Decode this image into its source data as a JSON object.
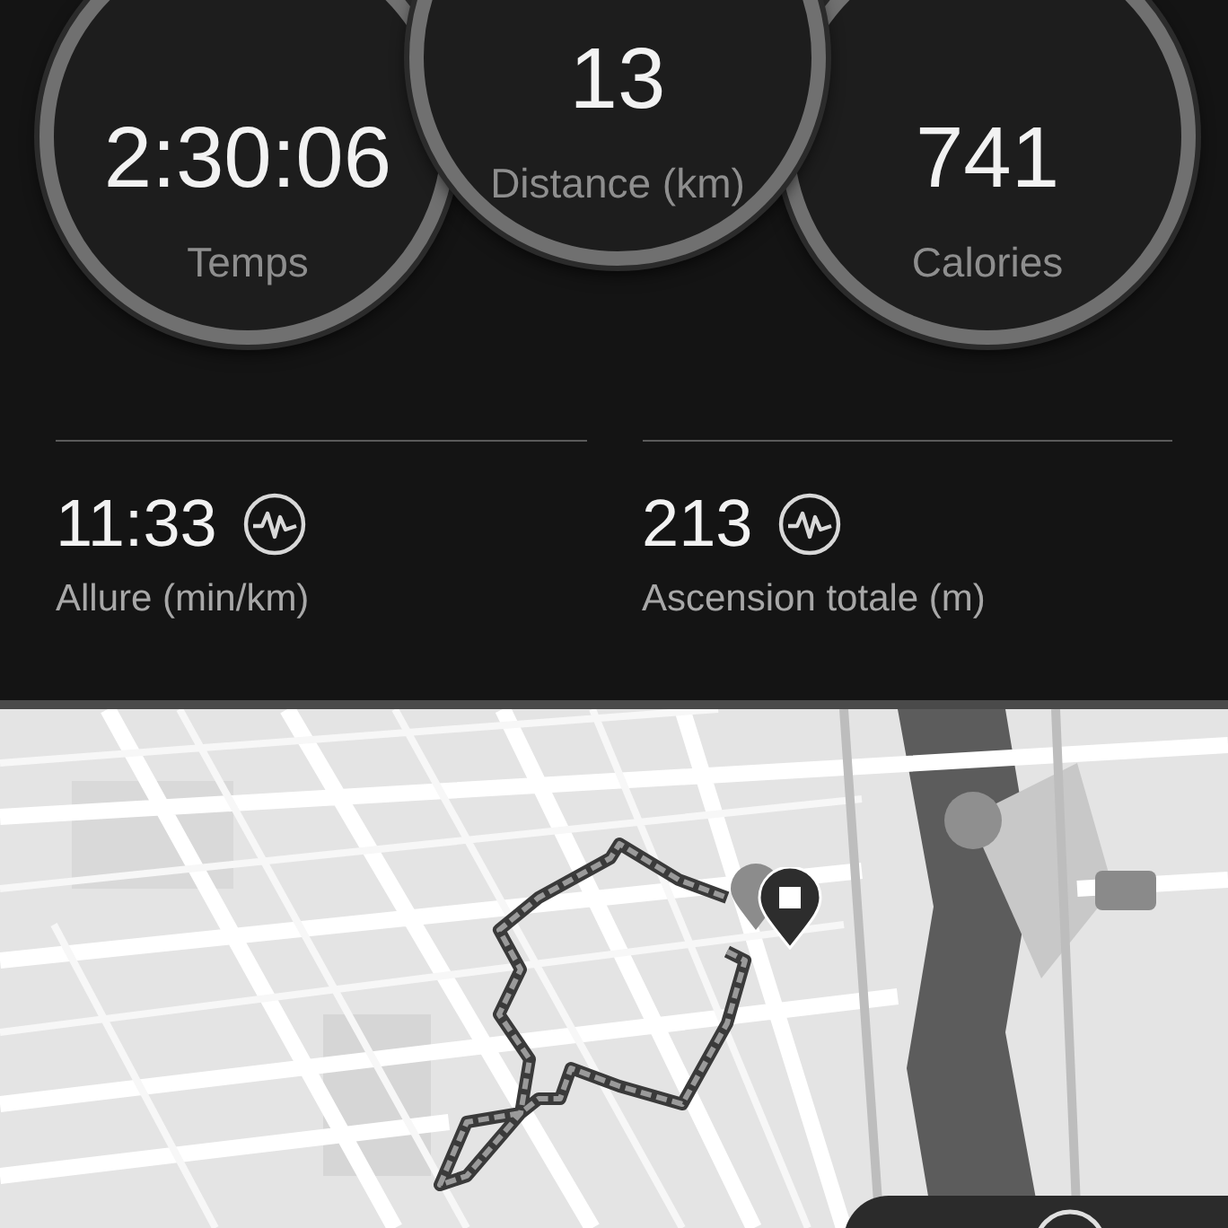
{
  "summary_circles": [
    {
      "value": "2:30:06",
      "label": "Temps"
    },
    {
      "value": "13",
      "label": "Distance (km)"
    },
    {
      "value": "741",
      "label": "Calories"
    }
  ],
  "metrics": [
    {
      "value": "11:33",
      "label": "Allure (min/km)"
    },
    {
      "value": "213",
      "label": "Ascension totale (m)"
    }
  ]
}
